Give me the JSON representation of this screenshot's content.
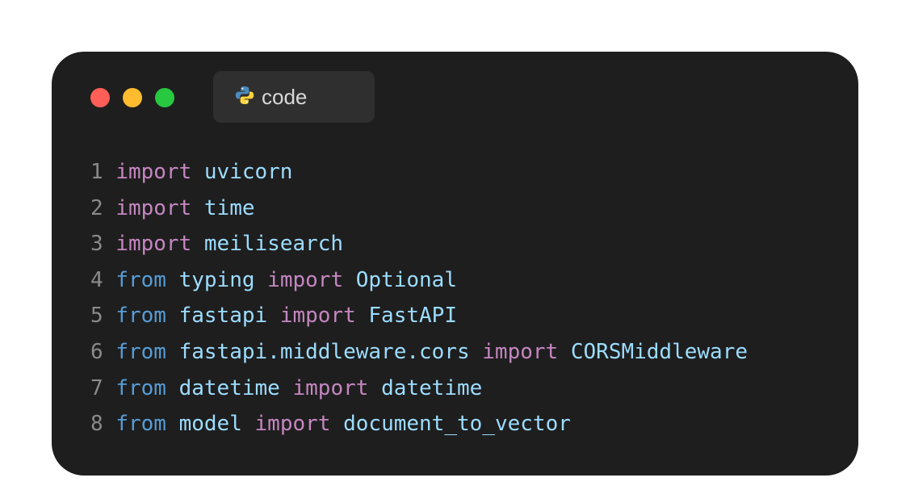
{
  "tab": {
    "icon": "python-icon",
    "label": "code"
  },
  "window_controls": {
    "close_color": "#ff5f57",
    "minimize_color": "#febc2e",
    "maximize_color": "#28c840"
  },
  "colors": {
    "background": "#1e1e1e",
    "keyword_import": "#c586c0",
    "keyword_from": "#569cd6",
    "identifier": "#9cdcfe",
    "line_number": "#8a8a8a"
  },
  "code": {
    "lines": [
      {
        "num": "1",
        "tokens": [
          {
            "t": "import",
            "k": "kw-import"
          },
          {
            "t": " "
          },
          {
            "t": "uvicorn",
            "k": "mod"
          }
        ]
      },
      {
        "num": "2",
        "tokens": [
          {
            "t": "import",
            "k": "kw-import"
          },
          {
            "t": " "
          },
          {
            "t": "time",
            "k": "mod"
          }
        ]
      },
      {
        "num": "3",
        "tokens": [
          {
            "t": "import",
            "k": "kw-import"
          },
          {
            "t": " "
          },
          {
            "t": "meilisearch",
            "k": "mod"
          }
        ]
      },
      {
        "num": "4",
        "tokens": [
          {
            "t": "from",
            "k": "kw-from"
          },
          {
            "t": " "
          },
          {
            "t": "typing",
            "k": "mod"
          },
          {
            "t": " "
          },
          {
            "t": "import",
            "k": "kw-import"
          },
          {
            "t": " "
          },
          {
            "t": "Optional",
            "k": "mod"
          }
        ]
      },
      {
        "num": "5",
        "tokens": [
          {
            "t": "from",
            "k": "kw-from"
          },
          {
            "t": " "
          },
          {
            "t": "fastapi",
            "k": "mod"
          },
          {
            "t": " "
          },
          {
            "t": "import",
            "k": "kw-import"
          },
          {
            "t": " "
          },
          {
            "t": "FastAPI",
            "k": "mod"
          }
        ]
      },
      {
        "num": "6",
        "tokens": [
          {
            "t": "from",
            "k": "kw-from"
          },
          {
            "t": " "
          },
          {
            "t": "fastapi.middleware.cors",
            "k": "mod"
          },
          {
            "t": " "
          },
          {
            "t": "import",
            "k": "kw-import"
          },
          {
            "t": " "
          },
          {
            "t": "CORSMiddleware",
            "k": "mod"
          }
        ]
      },
      {
        "num": "7",
        "tokens": [
          {
            "t": "from",
            "k": "kw-from"
          },
          {
            "t": " "
          },
          {
            "t": "datetime",
            "k": "mod"
          },
          {
            "t": " "
          },
          {
            "t": "import",
            "k": "kw-import"
          },
          {
            "t": " "
          },
          {
            "t": "datetime",
            "k": "mod"
          }
        ]
      },
      {
        "num": "8",
        "tokens": [
          {
            "t": "from",
            "k": "kw-from"
          },
          {
            "t": " "
          },
          {
            "t": "model",
            "k": "mod"
          },
          {
            "t": " "
          },
          {
            "t": "import",
            "k": "kw-import"
          },
          {
            "t": " "
          },
          {
            "t": "document_to_vector",
            "k": "mod"
          }
        ]
      }
    ]
  }
}
